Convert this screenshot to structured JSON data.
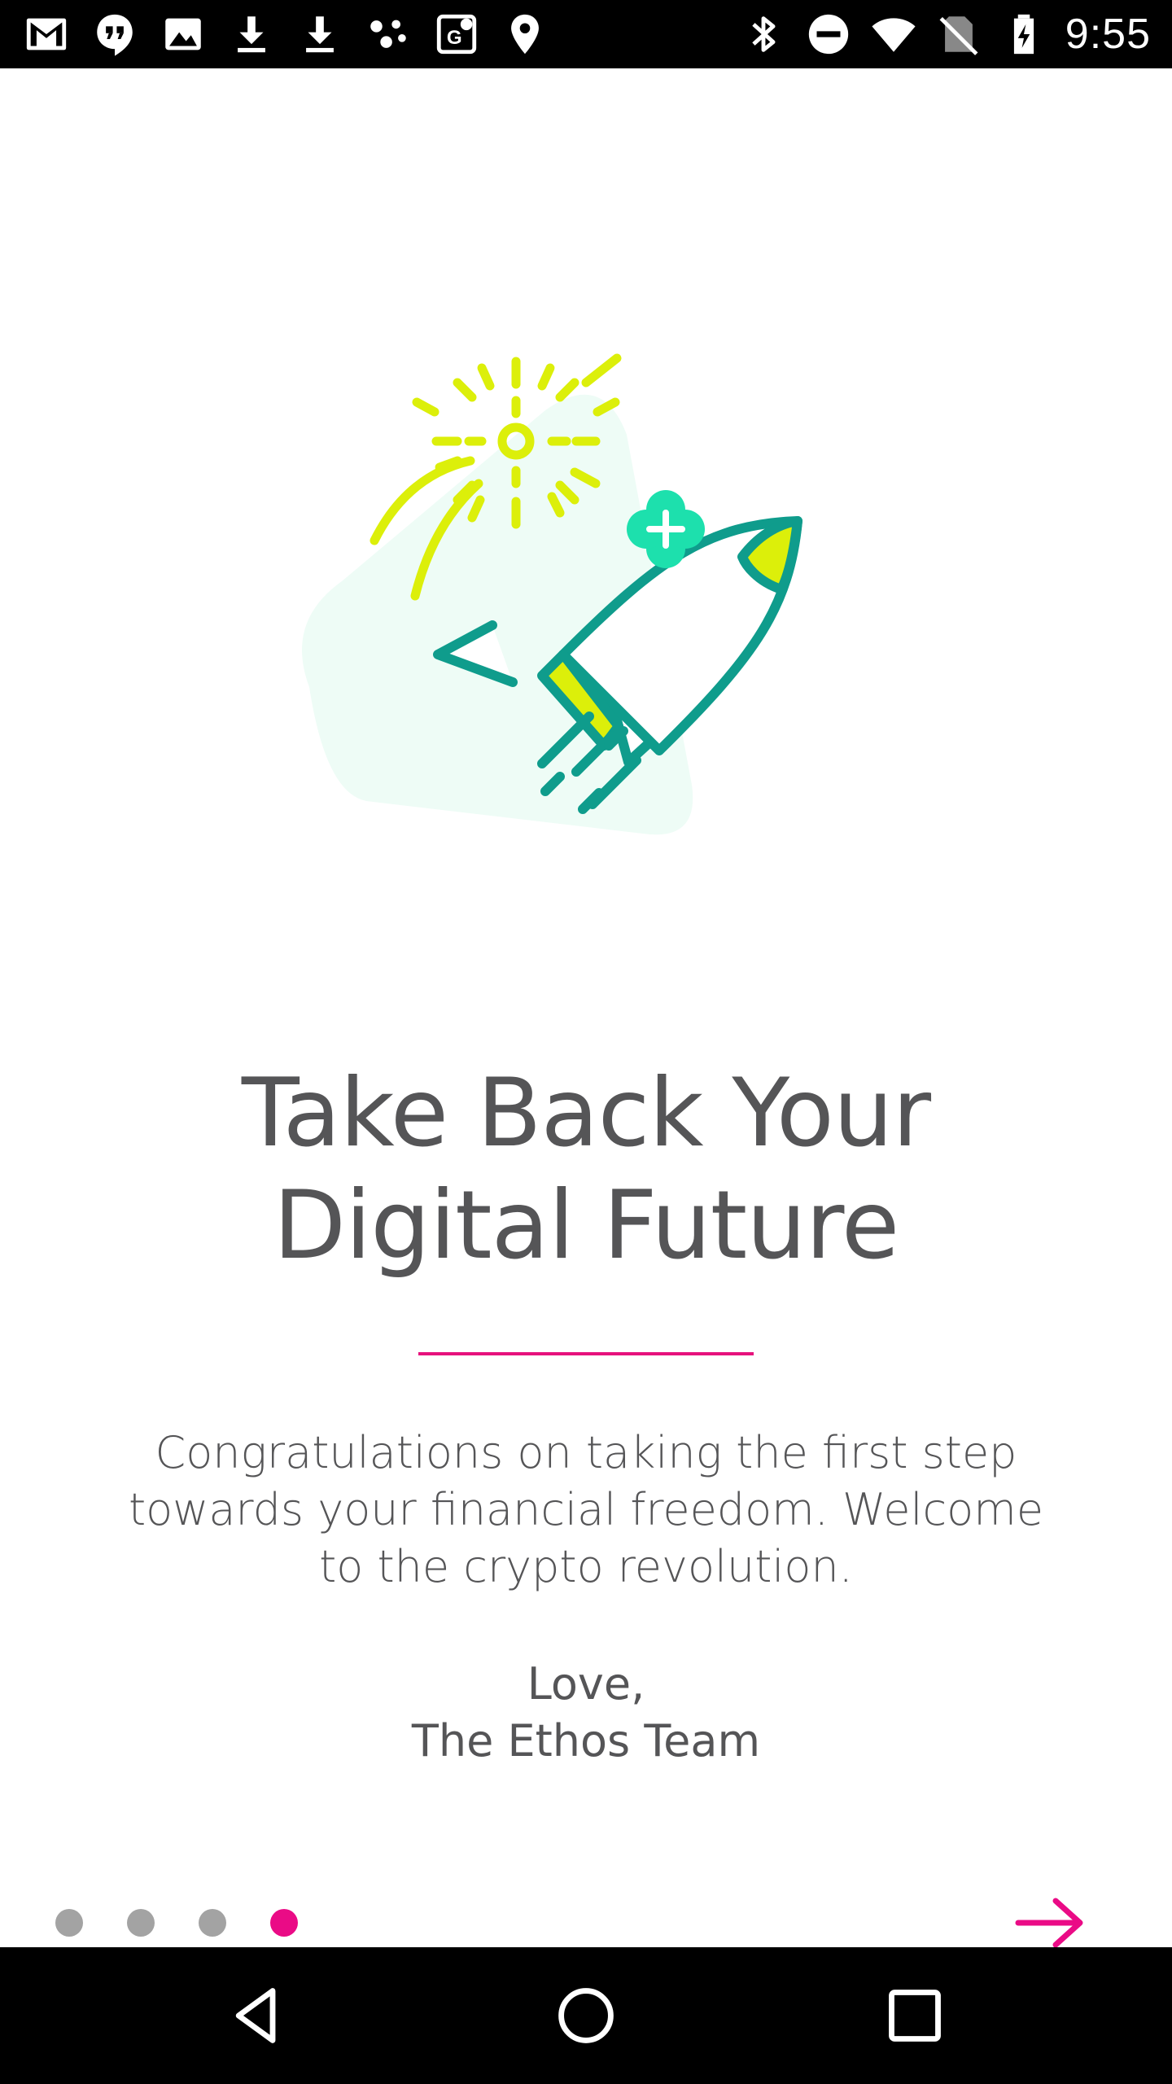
{
  "status_bar": {
    "time": "9:55",
    "left_icons": [
      "gmail-icon",
      "hangouts-icon",
      "image-icon",
      "download-icon",
      "download-icon",
      "dots-network-icon",
      "maps-icon",
      "location-icon"
    ],
    "right_icons": [
      "bluetooth-icon",
      "do-not-disturb-icon",
      "wifi-icon",
      "no-sim-icon",
      "battery-charging-icon"
    ]
  },
  "onboarding": {
    "illustration": "rocket-launch-illustration",
    "title_line1": "Take Back Your",
    "title_line2": "Digital Future",
    "body": "Congratulations on taking the first step towards your financial freedom. Welcome to the crypto revolution.",
    "signoff_line1": "Love,",
    "signoff_line2": "The Ethos Team",
    "page_indicator": {
      "total_pages": 4,
      "current_page": 4
    },
    "next_icon": "arrow-right-icon"
  },
  "nav_bar": {
    "back_icon": "back-triangle-icon",
    "home_icon": "home-circle-icon",
    "recents_icon": "recents-square-icon"
  },
  "colors": {
    "accent": "#ea0b86",
    "text": "#555557",
    "dot_inactive": "#a3a3a3",
    "rocket_teal": "#0f9c8c",
    "rocket_yellow": "#dcef0a",
    "emblem_green": "#1de0ad"
  }
}
